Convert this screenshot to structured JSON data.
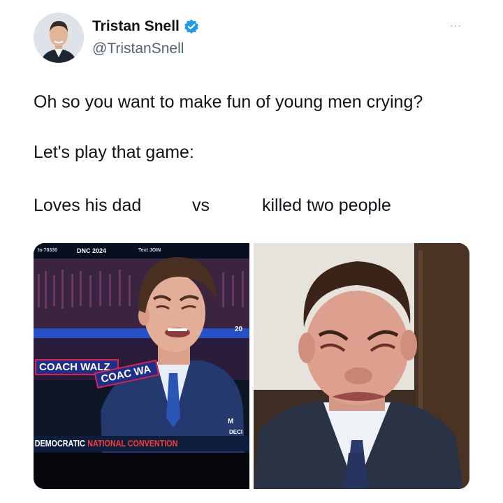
{
  "author": {
    "display_name": "Tristan Snell",
    "handle": "@TristanSnell",
    "verified_icon": "verified-badge-icon",
    "avatar_icon": "avatar"
  },
  "more_button": "···",
  "tweet": {
    "line1": "Oh so you want to make fun of young men crying?",
    "line2": "Let's play that game:",
    "left_caption": "Loves his dad",
    "vs": "vs",
    "right_caption": "killed two people"
  },
  "left_image": {
    "ticker_left": "to 70330",
    "ticker_dnc": "DNC 2024",
    "ticker_right": "Text JOIN",
    "sign1": "COACH WALZ",
    "sign2": "COAC WA",
    "banner_word1": "DEMOCRATIC",
    "banner_word2": "NATIONAL CONVENTION",
    "network_mark": "M",
    "deci_text": "DECI",
    "side_tag": "20"
  },
  "colors": {
    "verified_blue": "#1d9bf0",
    "banner_red": "#ff3a3a",
    "banner_bg": "#0d1e3c"
  }
}
